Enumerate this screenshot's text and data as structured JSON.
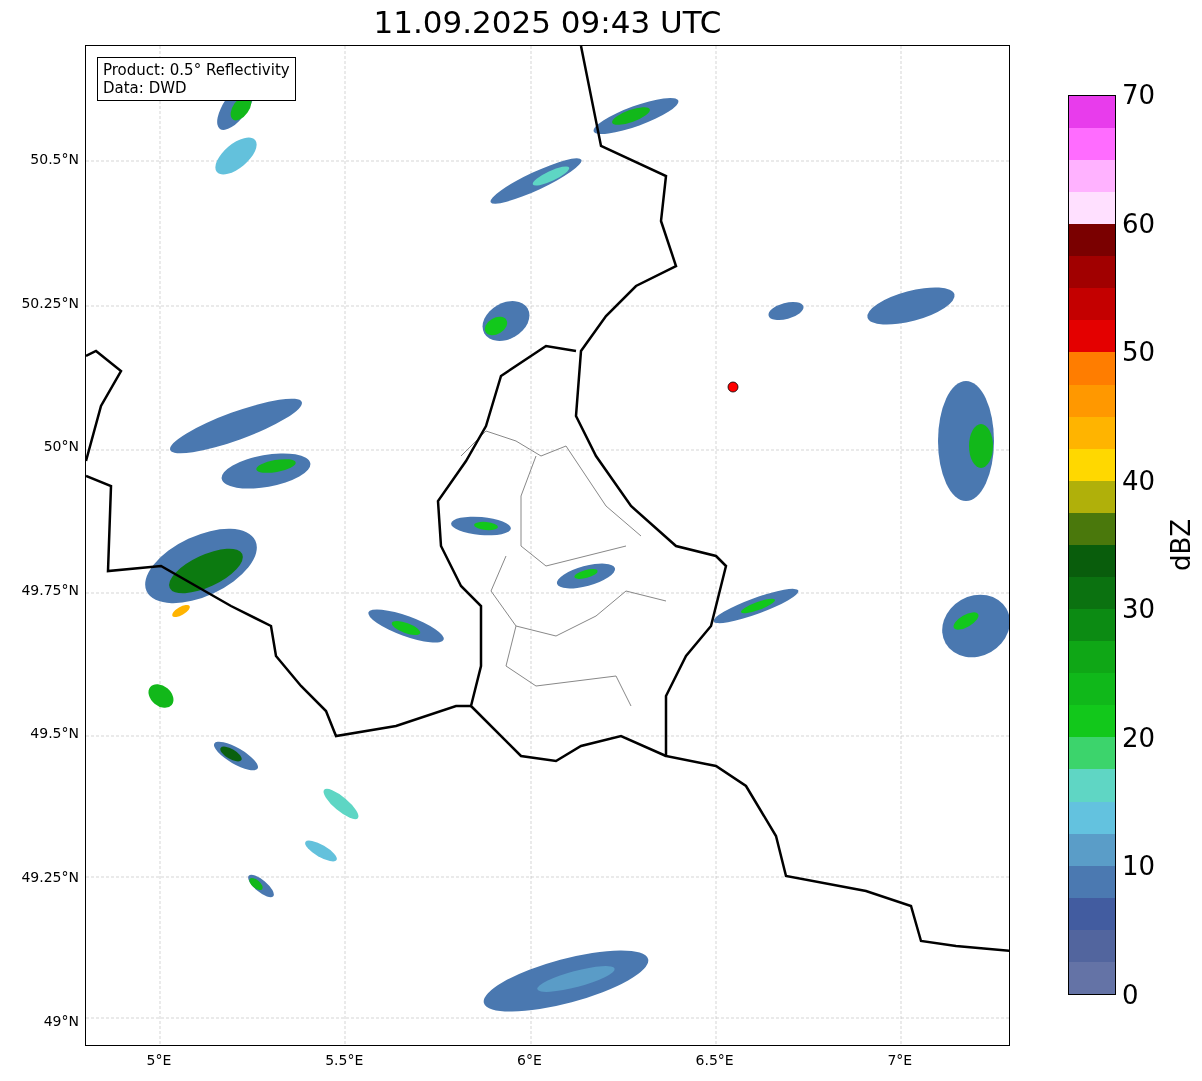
{
  "title": "11.09.2025 09:43 UTC",
  "map": {
    "info_box": [
      "Product: 0.5° Reflectivity",
      "Data: DWD"
    ],
    "y_ticks": [
      "50.5°N",
      "50.25°N",
      "50°N",
      "49.75°N",
      "49.5°N",
      "49.25°N",
      "49°N"
    ],
    "x_ticks": [
      "5°E",
      "5.5°E",
      "6°E",
      "6.5°E",
      "7°E"
    ]
  },
  "colorbar": {
    "label": "dBZ",
    "ticks": [
      "70",
      "60",
      "50",
      "40",
      "30",
      "20",
      "10",
      "0"
    ],
    "bands": [
      {
        "color": "#6473a6"
      },
      {
        "color": "#52659e"
      },
      {
        "color": "#425ca0"
      },
      {
        "color": "#4b79b1"
      },
      {
        "color": "#5a9dc8"
      },
      {
        "color": "#63c2df"
      },
      {
        "color": "#5fd6c4"
      },
      {
        "color": "#3cd46c"
      },
      {
        "color": "#12c81b"
      },
      {
        "color": "#10b81a"
      },
      {
        "color": "#0fa716"
      },
      {
        "color": "#0c8b13"
      },
      {
        "color": "#0b7210"
      },
      {
        "color": "#095d0c"
      },
      {
        "color": "#4a780c"
      },
      {
        "color": "#b0b00a"
      },
      {
        "color": "#ffd800"
      },
      {
        "color": "#ffb400"
      },
      {
        "color": "#ff9800"
      },
      {
        "color": "#ff7d00"
      },
      {
        "color": "#e40000"
      },
      {
        "color": "#c40000"
      },
      {
        "color": "#a10000"
      },
      {
        "color": "#7a0000"
      },
      {
        "color": "#ffe0ff"
      },
      {
        "color": "#ffb2ff"
      },
      {
        "color": "#ff6cff"
      },
      {
        "color": "#e83cec"
      }
    ]
  }
}
